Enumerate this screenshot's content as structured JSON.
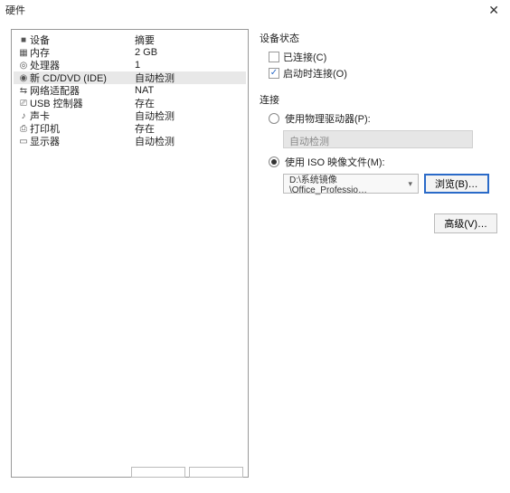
{
  "window": {
    "title": "硬件",
    "close_glyph": "✕"
  },
  "hw": {
    "items": [
      {
        "icon": "■",
        "name": "设备",
        "value": "摘要"
      },
      {
        "icon": "▦",
        "name": "内存",
        "value": "2 GB"
      },
      {
        "icon": "◎",
        "name": "处理器",
        "value": "1"
      },
      {
        "icon": "◉",
        "name": "新 CD/DVD (IDE)",
        "value": "自动检测",
        "selected": true
      },
      {
        "icon": "⇆",
        "name": "网络适配器",
        "value": "NAT"
      },
      {
        "icon": "⎚",
        "name": "USB 控制器",
        "value": "存在"
      },
      {
        "icon": "♪",
        "name": "声卡",
        "value": "自动检测"
      },
      {
        "icon": "⎙",
        "name": "打印机",
        "value": "存在"
      },
      {
        "icon": "▭",
        "name": "显示器",
        "value": "自动检测"
      }
    ]
  },
  "right": {
    "status_title": "设备状态",
    "chk_connected": "已连接(C)",
    "chk_startup": "启动时连接(O)",
    "conn_title": "连接",
    "radio_physical": "使用物理驱动器(P):",
    "physical_combo": "自动检测",
    "radio_iso": "使用 ISO 映像文件(M):",
    "iso_path": "D:\\系统镜像\\Office_Professio…",
    "browse": "浏览(B)…",
    "advanced": "高级(V)…"
  }
}
